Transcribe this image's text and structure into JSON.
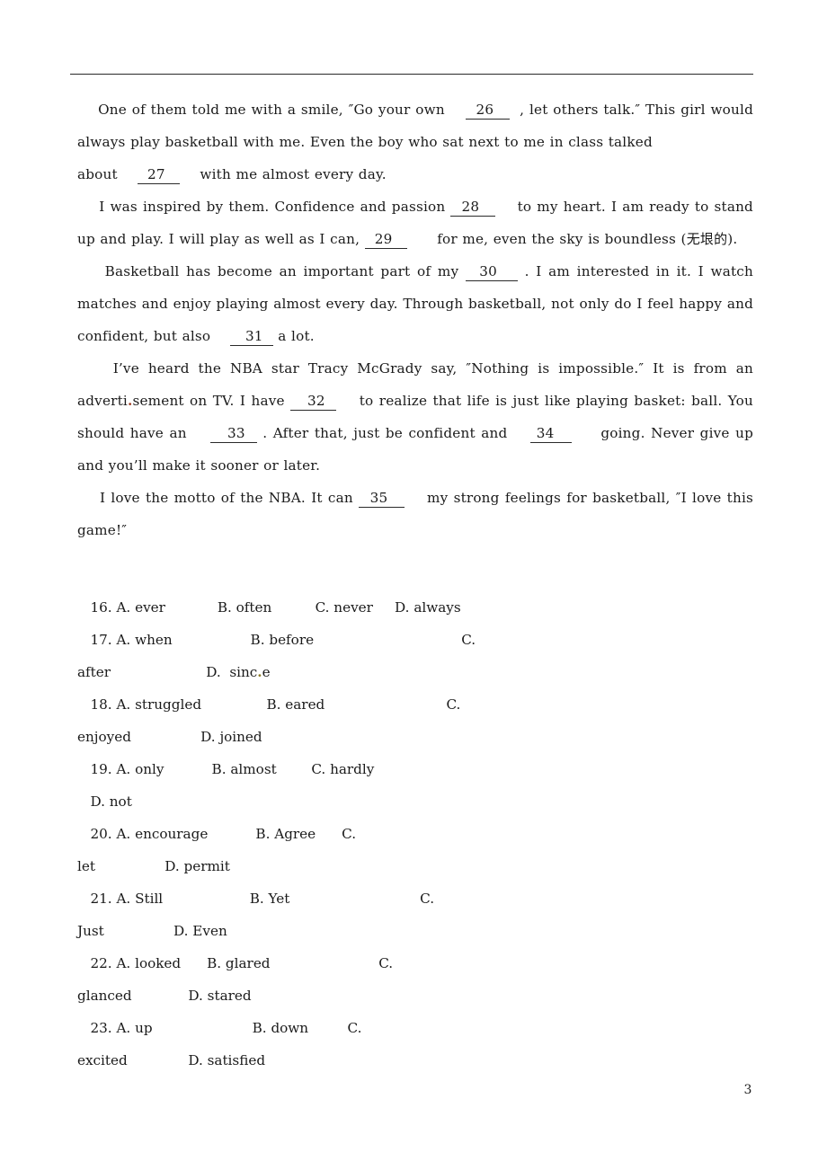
{
  "document": {
    "page_number": "3",
    "rule_color": "#2a2a2a"
  },
  "passage": {
    "paragraphs": [
      {
        "id": "p26",
        "text": "    One of them told me with a smile, \"Go your own    __26__   , let others talk.\" This girl would always play basketball with me. Even the boy who sat next to me in class talked\nabout    __27__     with me almost every day."
      },
      {
        "id": "p28",
        "text": "    I was inspired by them. Confidence and passion __28___    to my heart. I am ready to stand up and play. I will play as well as I can, __29___      for me, even the sky is boundless (无垠的)."
      },
      {
        "id": "p30",
        "text": "    Basketball has become an important part of my __30___ . I am interested in it. I watch matches and enjoy playing almost every day. Through basketball, not only do I feel happy and confident, but also    ___31__ a lot."
      },
      {
        "id": "p32",
        "text": "    I've heard the NBA star Tracy McGrady say, \"Nothing is impossible.\" It is from an advertisement on TV. I have ___32__    to realize that life is just like playing basket: ball. You should have an    ___33__ . After that, just be confident and    _34___     going. Never give up and you'll make it sooner or later."
      },
      {
        "id": "p35",
        "text": "    I love the motto of the NBA. It can __35___    my strong feelings for basketball, \"I love this game!\""
      }
    ]
  },
  "questions": [
    {
      "number": "16.",
      "options": [
        {
          "label": "A.",
          "text": "ever"
        },
        {
          "label": "B.",
          "text": "often"
        },
        {
          "label": "C.",
          "text": "never"
        },
        {
          "label": "D.",
          "text": "always"
        }
      ]
    },
    {
      "number": "17.",
      "options": [
        {
          "label": "A.",
          "text": "when"
        },
        {
          "label": "B.",
          "text": "before"
        },
        {
          "label": "C.",
          "text": "after"
        },
        {
          "label": "D.",
          "text": "since"
        }
      ]
    },
    {
      "number": "18.",
      "options": [
        {
          "label": "A.",
          "text": "struggled"
        },
        {
          "label": "B.",
          "text": "eared"
        },
        {
          "label": "C.",
          "text": "enjoyed"
        },
        {
          "label": "D.",
          "text": "joined"
        }
      ]
    },
    {
      "number": "19.",
      "options": [
        {
          "label": "A.",
          "text": "only"
        },
        {
          "label": "B.",
          "text": "almost"
        },
        {
          "label": "C.",
          "text": "hardly"
        },
        {
          "label": "D.",
          "text": "not"
        }
      ]
    },
    {
      "number": "20.",
      "options": [
        {
          "label": "A.",
          "text": "encourage"
        },
        {
          "label": "B.",
          "text": "Agree"
        },
        {
          "label": "C.",
          "text": "let"
        },
        {
          "label": "D.",
          "text": "permit"
        }
      ]
    },
    {
      "number": "21.",
      "options": [
        {
          "label": "A.",
          "text": "Still"
        },
        {
          "label": "B.",
          "text": "Yet"
        },
        {
          "label": "C.",
          "text": "Just"
        },
        {
          "label": "D.",
          "text": "Even"
        }
      ]
    },
    {
      "number": "22.",
      "options": [
        {
          "label": "A.",
          "text": "looked"
        },
        {
          "label": "B.",
          "text": "glared"
        },
        {
          "label": "C.",
          "text": "glanced"
        },
        {
          "label": "D.",
          "text": "stared"
        }
      ]
    },
    {
      "number": "23.",
      "options": [
        {
          "label": "A.",
          "text": "up"
        },
        {
          "label": "B.",
          "text": "down"
        },
        {
          "label": "C.",
          "text": "excited"
        },
        {
          "label": "D.",
          "text": "satisfied"
        }
      ]
    }
  ],
  "question_lines": [
    "   16. A. ever            B. often          C. never     D. always",
    "   17. A. when                  B. before                                  C.",
    "after                D. since",
    "   18. A. struggled               B. eared                            C.",
    "enjoyed                D. joined",
    "   19. A. only           B. almost        C. hardly",
    "   D. not",
    "   20. A. encourage           B. Agree      C.",
    "let                D. permit",
    "   21. A. Still                    B. Yet                              C.",
    "Just                D. Even",
    "   22. A. looked      B. glared                         C.",
    "glanced             D. stared",
    "   23. A. up                       B. down         C.",
    "excited              D. satisfied"
  ]
}
